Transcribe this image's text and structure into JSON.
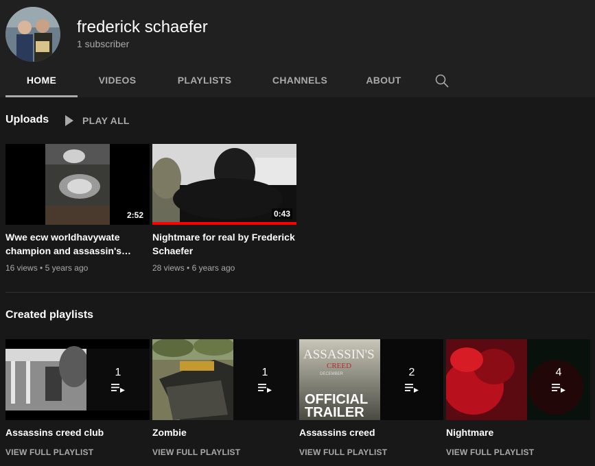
{
  "channel": {
    "name": "frederick schaefer",
    "subscribers": "1 subscriber"
  },
  "tabs": [
    {
      "label": "HOME",
      "active": true
    },
    {
      "label": "VIDEOS"
    },
    {
      "label": "PLAYLISTS"
    },
    {
      "label": "CHANNELS"
    },
    {
      "label": "ABOUT"
    }
  ],
  "uploads": {
    "title": "Uploads",
    "play_all": "PLAY ALL",
    "videos": [
      {
        "title": "Wwe ecw worldhavywate champion and assassin's…",
        "duration": "2:52",
        "views": "16 views",
        "age": "5 years ago",
        "watched_fraction": 0
      },
      {
        "title": "Nightmare for real by Frederick Schaefer",
        "duration": "0:43",
        "views": "28 views",
        "age": "6 years ago",
        "watched_fraction": 1.0
      }
    ]
  },
  "playlists": {
    "title": "Created playlists",
    "items": [
      {
        "title": "Assassins creed club",
        "count": "1",
        "link": "VIEW FULL PLAYLIST"
      },
      {
        "title": "Zombie",
        "count": "1",
        "link": "VIEW FULL PLAYLIST"
      },
      {
        "title": "Assassins creed",
        "count": "2",
        "link": "VIEW FULL PLAYLIST",
        "thumb_text": [
          "ASSASSIN'S",
          "CREED",
          "DECEMBER",
          "OFFICIAL",
          "TRAILER"
        ]
      },
      {
        "title": "Nightmare",
        "count": "4",
        "link": "VIEW FULL PLAYLIST"
      }
    ]
  },
  "colors": {
    "background": "#181818",
    "header": "#202020",
    "progress": "#ff0000",
    "muted_text": "#aaaaaa"
  },
  "icons": [
    "search-icon",
    "play-icon",
    "playlist-icon"
  ]
}
